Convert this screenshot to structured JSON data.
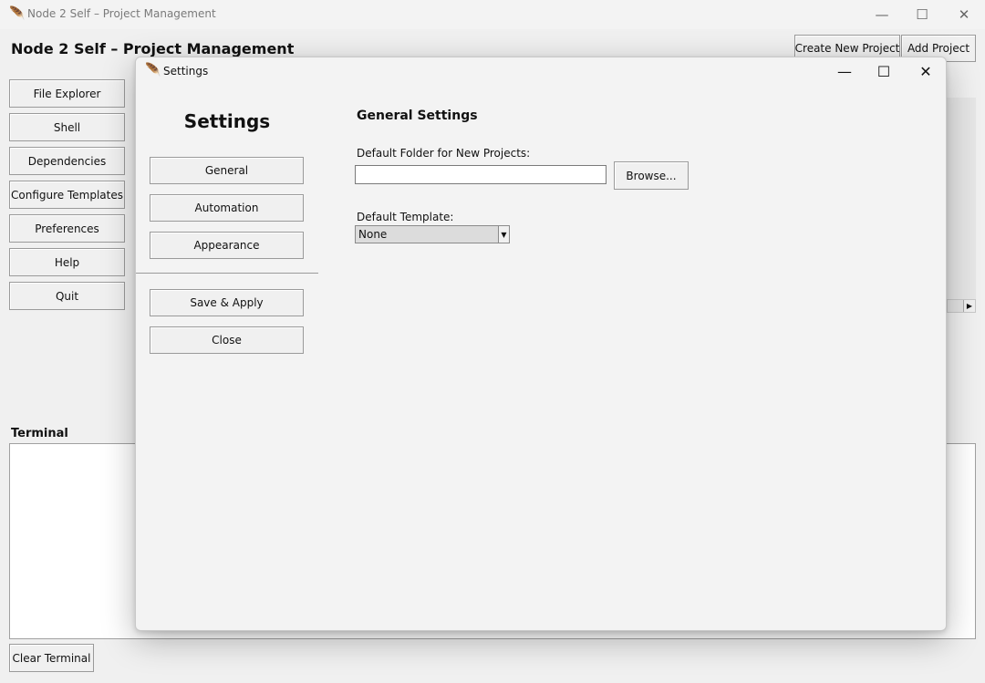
{
  "window": {
    "title": "Node 2 Self – Project Management",
    "minimize_glyph": "—",
    "maximize_glyph": "☐",
    "close_glyph": "✕",
    "app_icon": "feather-icon"
  },
  "header": {
    "heading": "Node 2 Self – Project Management",
    "create_new_project": "Create New Project",
    "add_project": "Add Project"
  },
  "sidebar": {
    "items": [
      {
        "label": "File Explorer"
      },
      {
        "label": "Shell"
      },
      {
        "label": "Dependencies"
      },
      {
        "label": "Configure Templates"
      },
      {
        "label": "Preferences"
      },
      {
        "label": "Help"
      },
      {
        "label": "Quit"
      }
    ]
  },
  "terminal": {
    "label": "Terminal",
    "clear_button": "Clear Terminal"
  },
  "settings_dialog": {
    "title": "Settings",
    "heading": "Settings",
    "nav": [
      {
        "label": "General"
      },
      {
        "label": "Automation"
      },
      {
        "label": "Appearance"
      }
    ],
    "save_apply": "Save & Apply",
    "close": "Close",
    "general": {
      "section_title": "General Settings",
      "default_folder_label": "Default Folder for New Projects:",
      "default_folder_value": "",
      "browse_button": "Browse...",
      "default_template_label": "Default Template:",
      "default_template_value": "None"
    }
  }
}
